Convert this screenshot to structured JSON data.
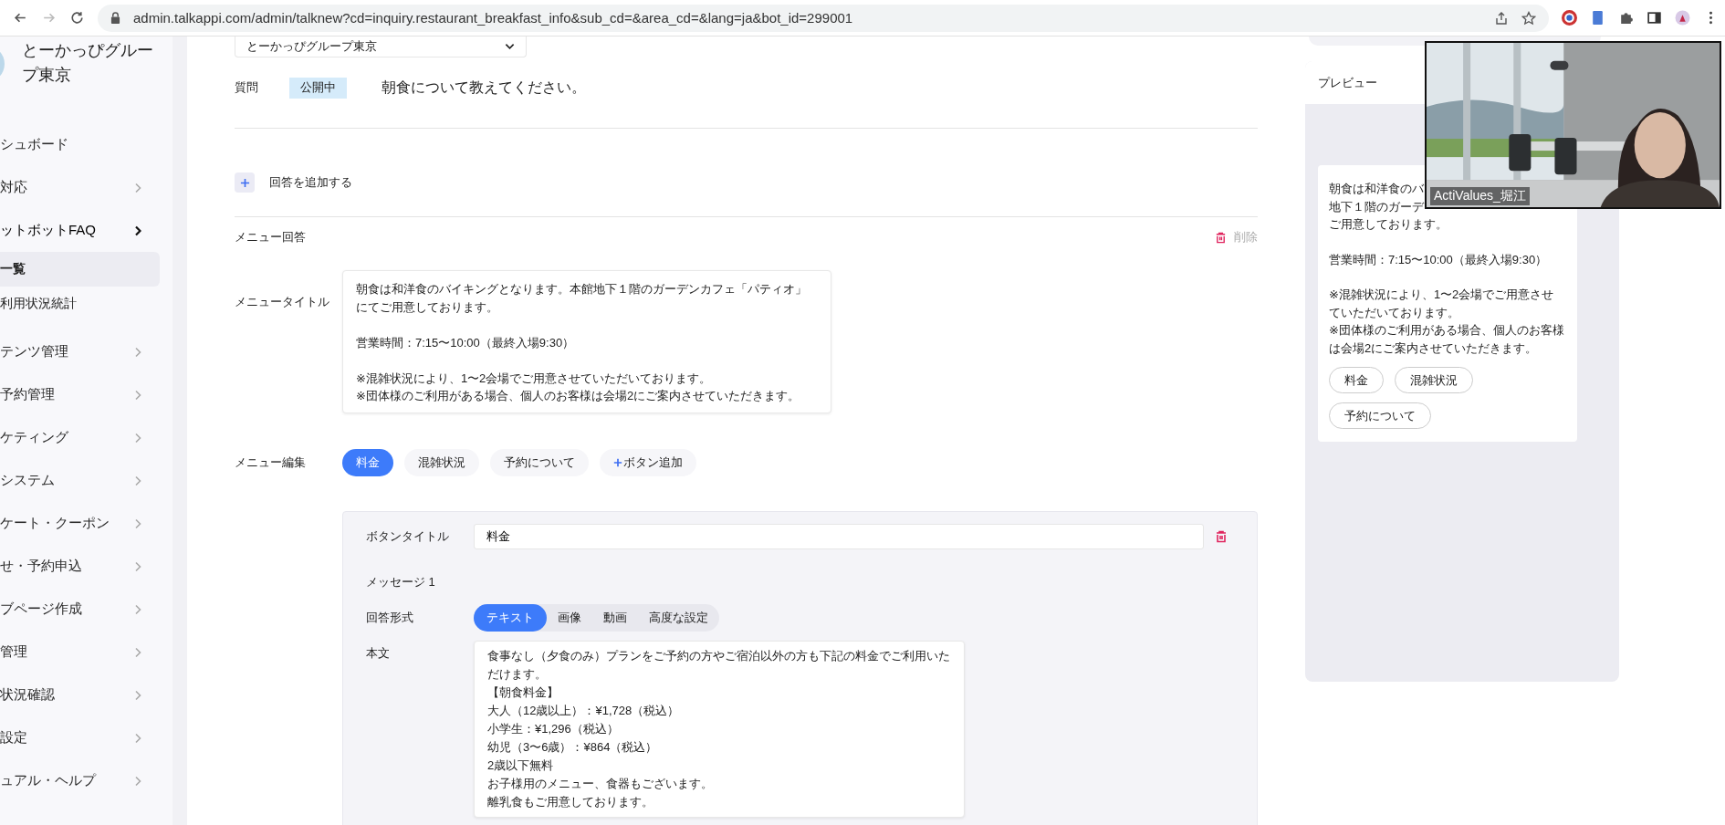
{
  "browser": {
    "url": "admin.talkappi.com/admin/talknew?cd=inquiry.restaurant_breakfast_info&sub_cd=&area_cd=&lang=ja&bot_id=299001"
  },
  "sidebar": {
    "group_name": "とーかっぴグループ東京",
    "items": [
      {
        "label": "シュボード",
        "kind": "link",
        "expanded": false
      },
      {
        "label": "対応",
        "kind": "group",
        "expanded": false
      },
      {
        "label": "ットボットFAQ",
        "kind": "group",
        "expanded": true,
        "children": [
          {
            "label": "一覧",
            "selected": true
          },
          {
            "label": "利用状況統計",
            "selected": false
          }
        ]
      },
      {
        "label": "テンツ管理",
        "kind": "group",
        "expanded": false
      },
      {
        "label": "予約管理",
        "kind": "group",
        "expanded": false
      },
      {
        "label": "ケティング",
        "kind": "group",
        "expanded": false
      },
      {
        "label": "システム",
        "kind": "group",
        "expanded": false
      },
      {
        "label": "ケート・クーポン",
        "kind": "group",
        "expanded": false
      },
      {
        "label": "せ・予約申込",
        "kind": "group",
        "expanded": false
      },
      {
        "label": "ブページ作成",
        "kind": "group",
        "expanded": false
      },
      {
        "label": "管理",
        "kind": "group",
        "expanded": false
      },
      {
        "label": "状況確認",
        "kind": "group",
        "expanded": false
      },
      {
        "label": "設定",
        "kind": "group",
        "expanded": false
      },
      {
        "label": "ュアル・ヘルプ",
        "kind": "group",
        "expanded": false
      }
    ]
  },
  "main": {
    "office_select": {
      "value": "とーかっぴグループ東京"
    },
    "question": {
      "label": "質問",
      "status": "公開中",
      "text": "朝食について教えてください。"
    },
    "add_answer": {
      "label": "回答を追加する"
    },
    "menu_answer": {
      "label": "メニュー回答",
      "delete_label": "削除"
    },
    "menu_title": {
      "label": "メニュータイトル",
      "paragraphs": [
        [
          "朝食は和洋食のバイキングとなります。本館地下１階のガーデンカフェ「パティオ」にてご用意しております。"
        ],
        [
          "営業時間：7:15〜10:00（最終入場9:30）"
        ],
        [
          "※混雑状況により、1〜2会場でご用意させていただいております。",
          "※団体様のご利用がある場合、個人のお客様は会場2にご案内させていただきます。"
        ]
      ]
    },
    "menu_edit": {
      "label": "メニュー編集",
      "buttons": [
        {
          "label": "料金",
          "selected": true
        },
        {
          "label": "混雑状況",
          "selected": false
        },
        {
          "label": "予約について",
          "selected": false
        }
      ],
      "add_label": "ボタン追加"
    },
    "button_title": {
      "label": "ボタンタイトル",
      "value": "料金"
    },
    "message_label": "メッセージ 1",
    "answer_format": {
      "label": "回答形式",
      "options": [
        {
          "label": "テキスト",
          "selected": true
        },
        {
          "label": "画像",
          "selected": false
        },
        {
          "label": "動画",
          "selected": false
        },
        {
          "label": "高度な設定",
          "selected": false
        }
      ]
    },
    "body": {
      "label": "本文",
      "lines": [
        "食事なし（夕食のみ）プランをご予約の方やご宿泊以外の方も下記の料金でご利用いただけます。",
        "【朝食料金】",
        "大人（12歳以上）：¥1,728（税込）",
        "小学生：¥1,296（税込）",
        "幼児（3〜6歳）：¥864（税込）",
        "2歳以下無料",
        "お子様用のメニュー、食器もございます。",
        "離乳食もご用意しております。"
      ]
    }
  },
  "preview": {
    "title": "プレビュー",
    "paragraphs": [
      [
        "朝食は和洋食のバ",
        "地下１階のガーデ",
        "ご用意しております。"
      ],
      [
        "営業時間：7:15〜10:00（最終入場9:30）"
      ],
      [
        "※混雑状況により、1〜2会場でご用意させ",
        "ていただいております。",
        "※団体様のご利用がある場合、個人のお客様",
        "は会場2にご案内させていただきます。"
      ]
    ],
    "buttons": [
      "料金",
      "混雑状況",
      "予約について"
    ]
  },
  "video": {
    "name": "ActiValues_堀江"
  }
}
